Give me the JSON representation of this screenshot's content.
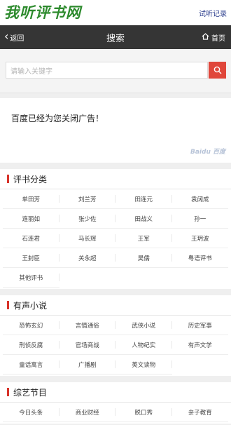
{
  "header": {
    "logo": "我听评书网",
    "history_link": "试听记录"
  },
  "nav": {
    "back_label": "返回",
    "title": "搜索",
    "home_label": "首页"
  },
  "search": {
    "placeholder": "请输入关键字"
  },
  "ad": {
    "text": "百度已经为您关闭广告！",
    "logo_text": "Baidu 百度"
  },
  "sections": [
    {
      "title": "评书分类",
      "items": [
        "单田芳",
        "刘兰芳",
        "田连元",
        "袁阔成",
        "连丽如",
        "张少佐",
        "田战义",
        "孙一",
        "石连君",
        "马长辉",
        "王军",
        "王玥波",
        "王封臣",
        "关永超",
        "昊儒",
        "粤语评书",
        "其他评书"
      ]
    },
    {
      "title": "有声小说",
      "items": [
        "恐怖玄幻",
        "言情通俗",
        "武侠小说",
        "历史军事",
        "刑侦反腐",
        "官场商战",
        "人物纪实",
        "有声文学",
        "童话寓言",
        "广播剧",
        "英文读物"
      ]
    },
    {
      "title": "综艺节目",
      "items": [
        "今日头条",
        "商业财经",
        "脱口秀",
        "亲子教育"
      ]
    }
  ],
  "colors": {
    "logo": "#2e8b2e",
    "navbar": "#353535",
    "accent": "#d8332a",
    "search_button": "#e0463a"
  }
}
